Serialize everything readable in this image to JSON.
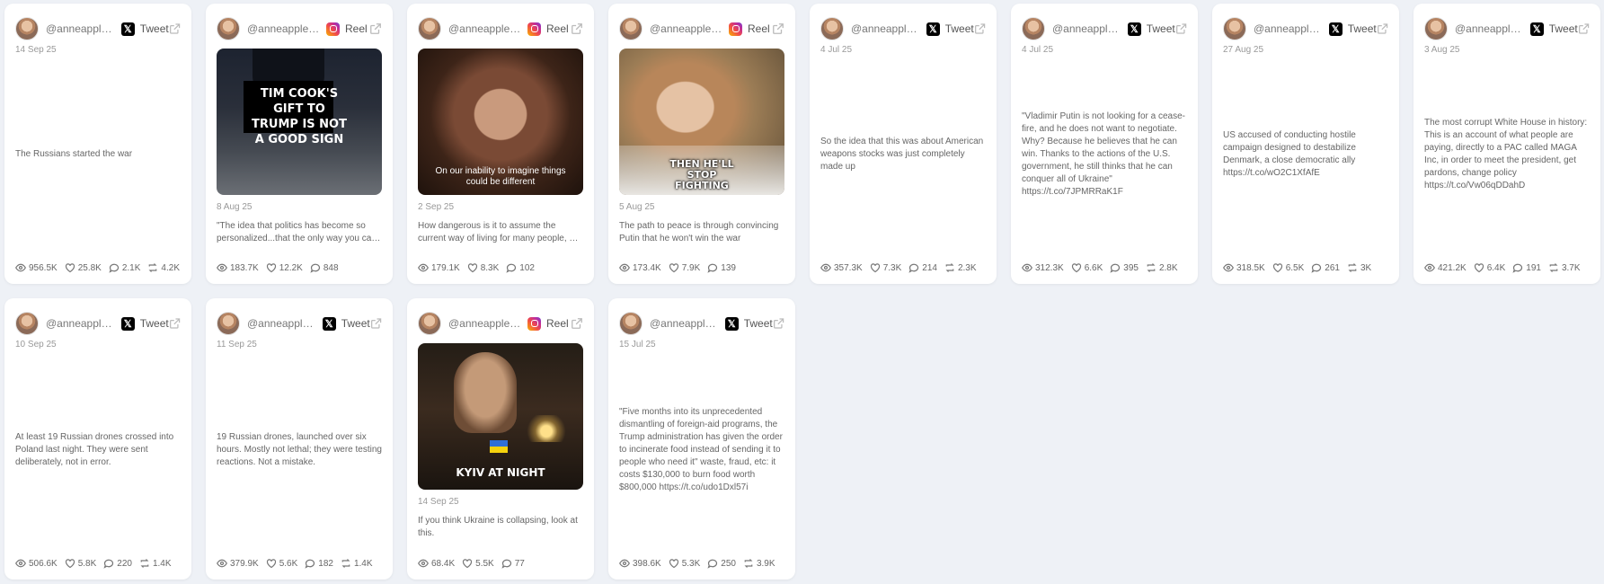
{
  "cards": [
    {
      "handle": "@anneapplebaum",
      "type": "Tweet",
      "platform": "x",
      "date": "14 Sep 25",
      "text": "The Russians started the war",
      "views": "956.5K",
      "likes": "25.8K",
      "comments": "2.1K",
      "reposts": "4.2K"
    },
    {
      "handle": "@anneapplebaum",
      "type": "Reel",
      "platform": "instagram",
      "date": "8 Aug 25",
      "text": "\"The idea that politics has become so personalized...that the only way you can get anything done is by bribing the president",
      "views": "183.7K",
      "likes": "12.2K",
      "comments": "848",
      "reposts": "",
      "caption": "TIM COOK'S GIFT TO TRUMP IS NOT A GOOD SIGN",
      "subcaption": ""
    },
    {
      "handle": "@anneapplebaum",
      "type": "Reel",
      "platform": "instagram",
      "date": "2 Sep 25",
      "text": "How dangerous is it to assume the current way of living for many people, will stay the same forever",
      "views": "179.1K",
      "likes": "8.3K",
      "comments": "102",
      "reposts": "",
      "caption": "",
      "subcaption": "On our inability to imagine things could be different"
    },
    {
      "handle": "@anneapplebaum",
      "type": "Reel",
      "platform": "instagram",
      "date": "5 Aug 25",
      "text": "The path to peace is through convincing Putin that he won't win the war",
      "views": "173.4K",
      "likes": "7.9K",
      "comments": "139",
      "reposts": "",
      "caption": "THEN HE'LL STOP FIGHTING",
      "subcaption": ""
    },
    {
      "handle": "@anneapplebaum",
      "type": "Tweet",
      "platform": "x",
      "date": "4 Jul 25",
      "text": "So the idea that this was about American weapons stocks was just completely made up",
      "views": "357.3K",
      "likes": "7.3K",
      "comments": "214",
      "reposts": "2.3K"
    },
    {
      "handle": "@anneapplebaum",
      "type": "Tweet",
      "platform": "x",
      "date": "4 Jul 25",
      "text": "\"Vladimir Putin is not looking for a cease-fire, and he does not want to negotiate. Why? Because he believes that he can win. Thanks to the actions of the U.S. government, he still thinks that he can conquer all of Ukraine\" https://t.co/7JPMRRaK1F",
      "views": "312.3K",
      "likes": "6.6K",
      "comments": "395",
      "reposts": "2.8K"
    },
    {
      "handle": "@anneapplebaum",
      "type": "Tweet",
      "platform": "x",
      "date": "27 Aug 25",
      "text": "US accused of conducting hostile campaign designed to destabilize Denmark, a close democratic ally https://t.co/wO2C1XfAfE",
      "views": "318.5K",
      "likes": "6.5K",
      "comments": "261",
      "reposts": "3K"
    },
    {
      "handle": "@anneapplebaum",
      "type": "Tweet",
      "platform": "x",
      "date": "3 Aug 25",
      "text": "The most corrupt White House in history: This is an account of what people are paying, directly to a PAC called MAGA Inc, in order to meet the president, get pardons, change policy https://t.co/Vw06qDDahD",
      "views": "421.2K",
      "likes": "6.4K",
      "comments": "191",
      "reposts": "3.7K"
    },
    {
      "handle": "@anneapplebaum",
      "type": "Tweet",
      "platform": "x",
      "date": "10 Sep 25",
      "text": "At least 19 Russian drones crossed into Poland last night. They were sent deliberately, not in error.",
      "views": "506.6K",
      "likes": "5.8K",
      "comments": "220",
      "reposts": "1.4K"
    },
    {
      "handle": "@anneapplebaum",
      "type": "Tweet",
      "platform": "x",
      "date": "11 Sep 25",
      "text": "19 Russian drones, launched over six hours. Mostly not lethal; they were testing reactions. Not a mistake.",
      "views": "379.9K",
      "likes": "5.6K",
      "comments": "182",
      "reposts": "1.4K"
    },
    {
      "handle": "@anneapplebaum",
      "type": "Reel",
      "platform": "instagram",
      "date": "14 Sep 25",
      "text": "If you think Ukraine is collapsing, look at this.",
      "views": "68.4K",
      "likes": "5.5K",
      "comments": "77",
      "reposts": "",
      "caption": "KYIV AT NIGHT",
      "subcaption": ""
    },
    {
      "handle": "@anneapplebaum",
      "type": "Tweet",
      "platform": "x",
      "date": "15 Jul 25",
      "text": "\"Five months into its unprecedented dismantling of foreign-aid programs, the Trump administration has given the order to incinerate food instead of sending it to people who need it\" waste, fraud, etc: it costs $130,000 to burn food worth $800,000 https://t.co/udo1Dxl57i",
      "views": "398.6K",
      "likes": "5.3K",
      "comments": "250",
      "reposts": "3.9K"
    }
  ]
}
